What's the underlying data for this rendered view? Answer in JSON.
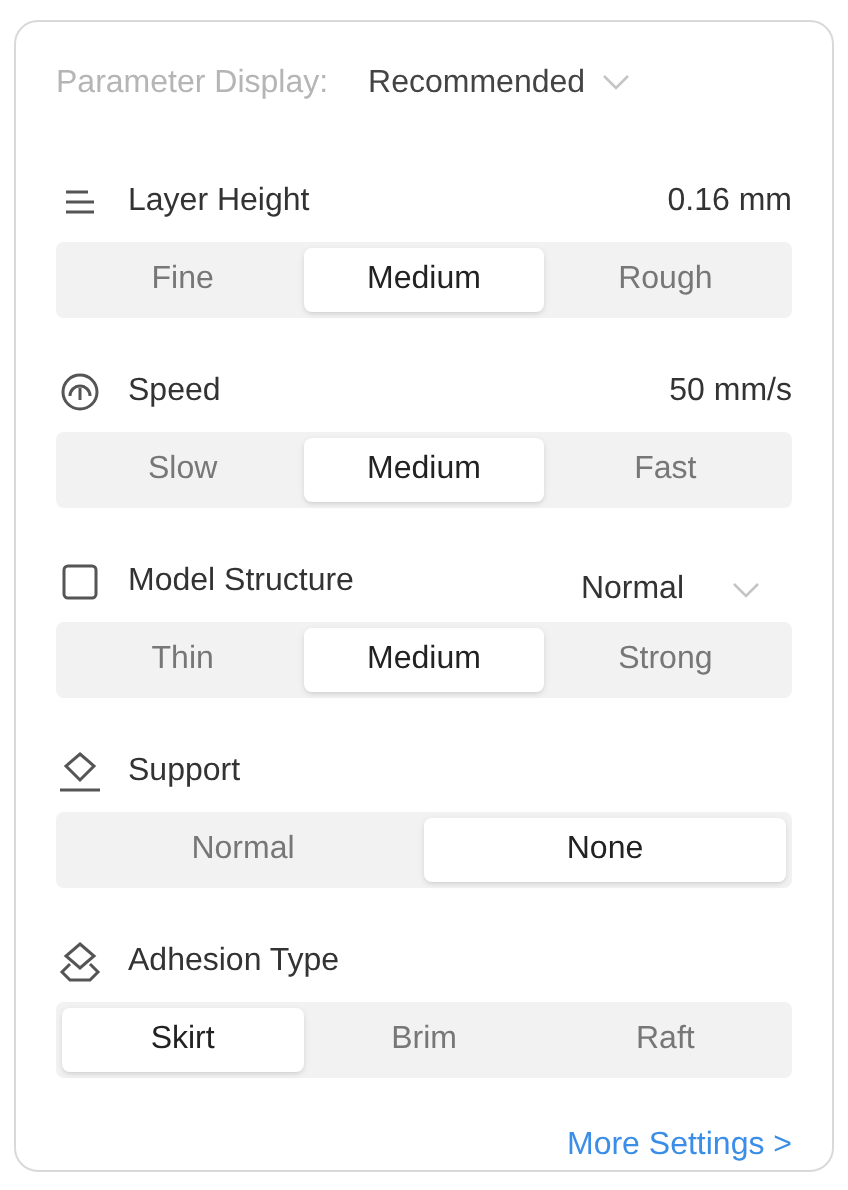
{
  "parameter_display": {
    "label": "Parameter Display:",
    "value": "Recommended"
  },
  "sections": [
    {
      "title": "Layer Height",
      "kind": "value",
      "value": "0.16 mm",
      "options": [
        {
          "label": "Fine",
          "selected": false
        },
        {
          "label": "Medium",
          "selected": true
        },
        {
          "label": "Rough",
          "selected": false
        }
      ]
    },
    {
      "title": "Speed",
      "kind": "value",
      "value": "50 mm/s",
      "options": [
        {
          "label": "Slow",
          "selected": false
        },
        {
          "label": "Medium",
          "selected": true
        },
        {
          "label": "Fast",
          "selected": false
        }
      ]
    },
    {
      "title": "Model Structure",
      "kind": "dropdown",
      "value": "Normal",
      "options": [
        {
          "label": "Thin",
          "selected": false
        },
        {
          "label": "Medium",
          "selected": true
        },
        {
          "label": "Strong",
          "selected": false
        }
      ]
    },
    {
      "title": "Support",
      "kind": "none",
      "options": [
        {
          "label": "Normal",
          "selected": false
        },
        {
          "label": "None",
          "selected": true
        }
      ]
    },
    {
      "title": "Adhesion Type",
      "kind": "none",
      "options": [
        {
          "label": "Skirt",
          "selected": true
        },
        {
          "label": "Brim",
          "selected": false
        },
        {
          "label": "Raft",
          "selected": false
        }
      ]
    }
  ],
  "more_link": "More Settings >"
}
